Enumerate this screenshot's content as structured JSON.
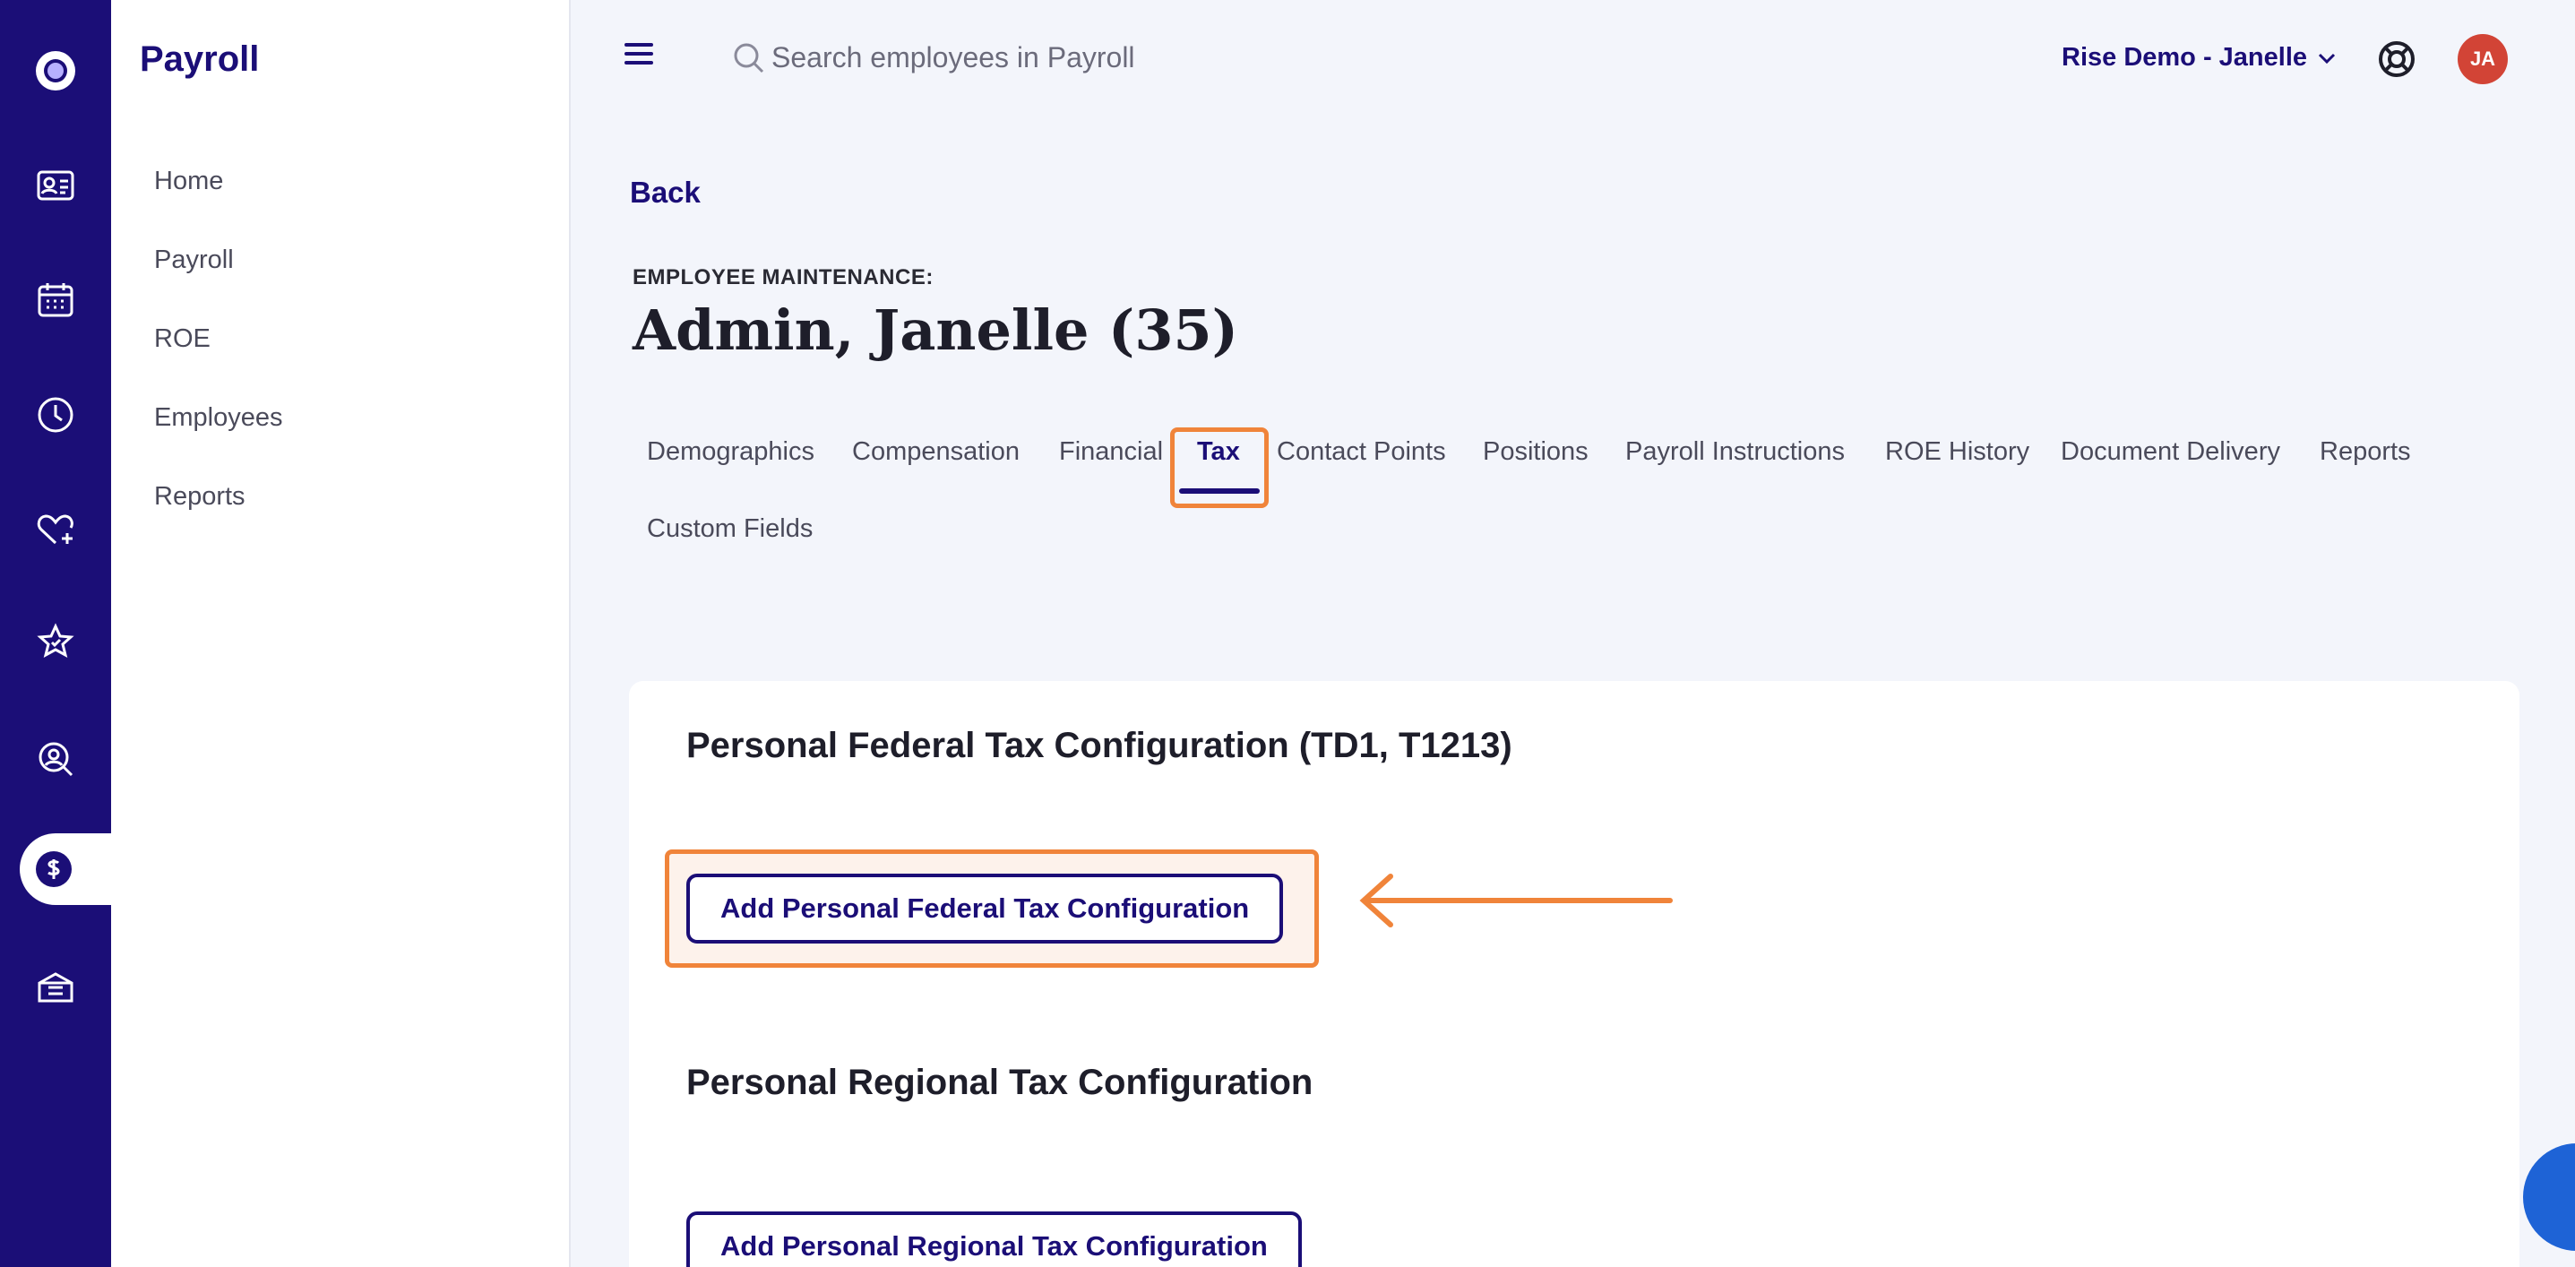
{
  "rail": {
    "items": [
      {
        "icon": "logo-icon"
      },
      {
        "icon": "id-card-icon"
      },
      {
        "icon": "calendar-icon"
      },
      {
        "icon": "clock-icon"
      },
      {
        "icon": "heart-plus-icon"
      },
      {
        "icon": "star-icon"
      },
      {
        "icon": "search-person-icon"
      },
      {
        "icon": "dollar-icon",
        "active": true
      },
      {
        "icon": "box-icon"
      }
    ]
  },
  "sidebar": {
    "title": "Payroll",
    "items": [
      "Home",
      "Payroll",
      "ROE",
      "Employees",
      "Reports"
    ]
  },
  "header": {
    "search_placeholder": "Search employees in Payroll",
    "account": "Rise Demo - Janelle",
    "avatar_initials": "JA"
  },
  "main": {
    "back_label": "Back",
    "kicker": "EMPLOYEE MAINTENANCE:",
    "title": "Admin, Janelle (35)",
    "tabs": [
      "Demographics",
      "Compensation",
      "Financial",
      "Tax",
      "Contact Points",
      "Positions",
      "Payroll Instructions",
      "ROE History",
      "Document Delivery",
      "Reports",
      "Custom Fields"
    ],
    "active_tab": "Tax",
    "federal_section_title": "Personal Federal Tax Configuration (TD1, T1213)",
    "federal_button": "Add Personal Federal Tax Configuration",
    "regional_section_title": "Personal Regional Tax Configuration",
    "regional_button": "Add Personal Regional Tax Configuration"
  },
  "colors": {
    "brand": "#1b0e77",
    "highlight": "#f0843a",
    "avatar": "#d24436"
  }
}
